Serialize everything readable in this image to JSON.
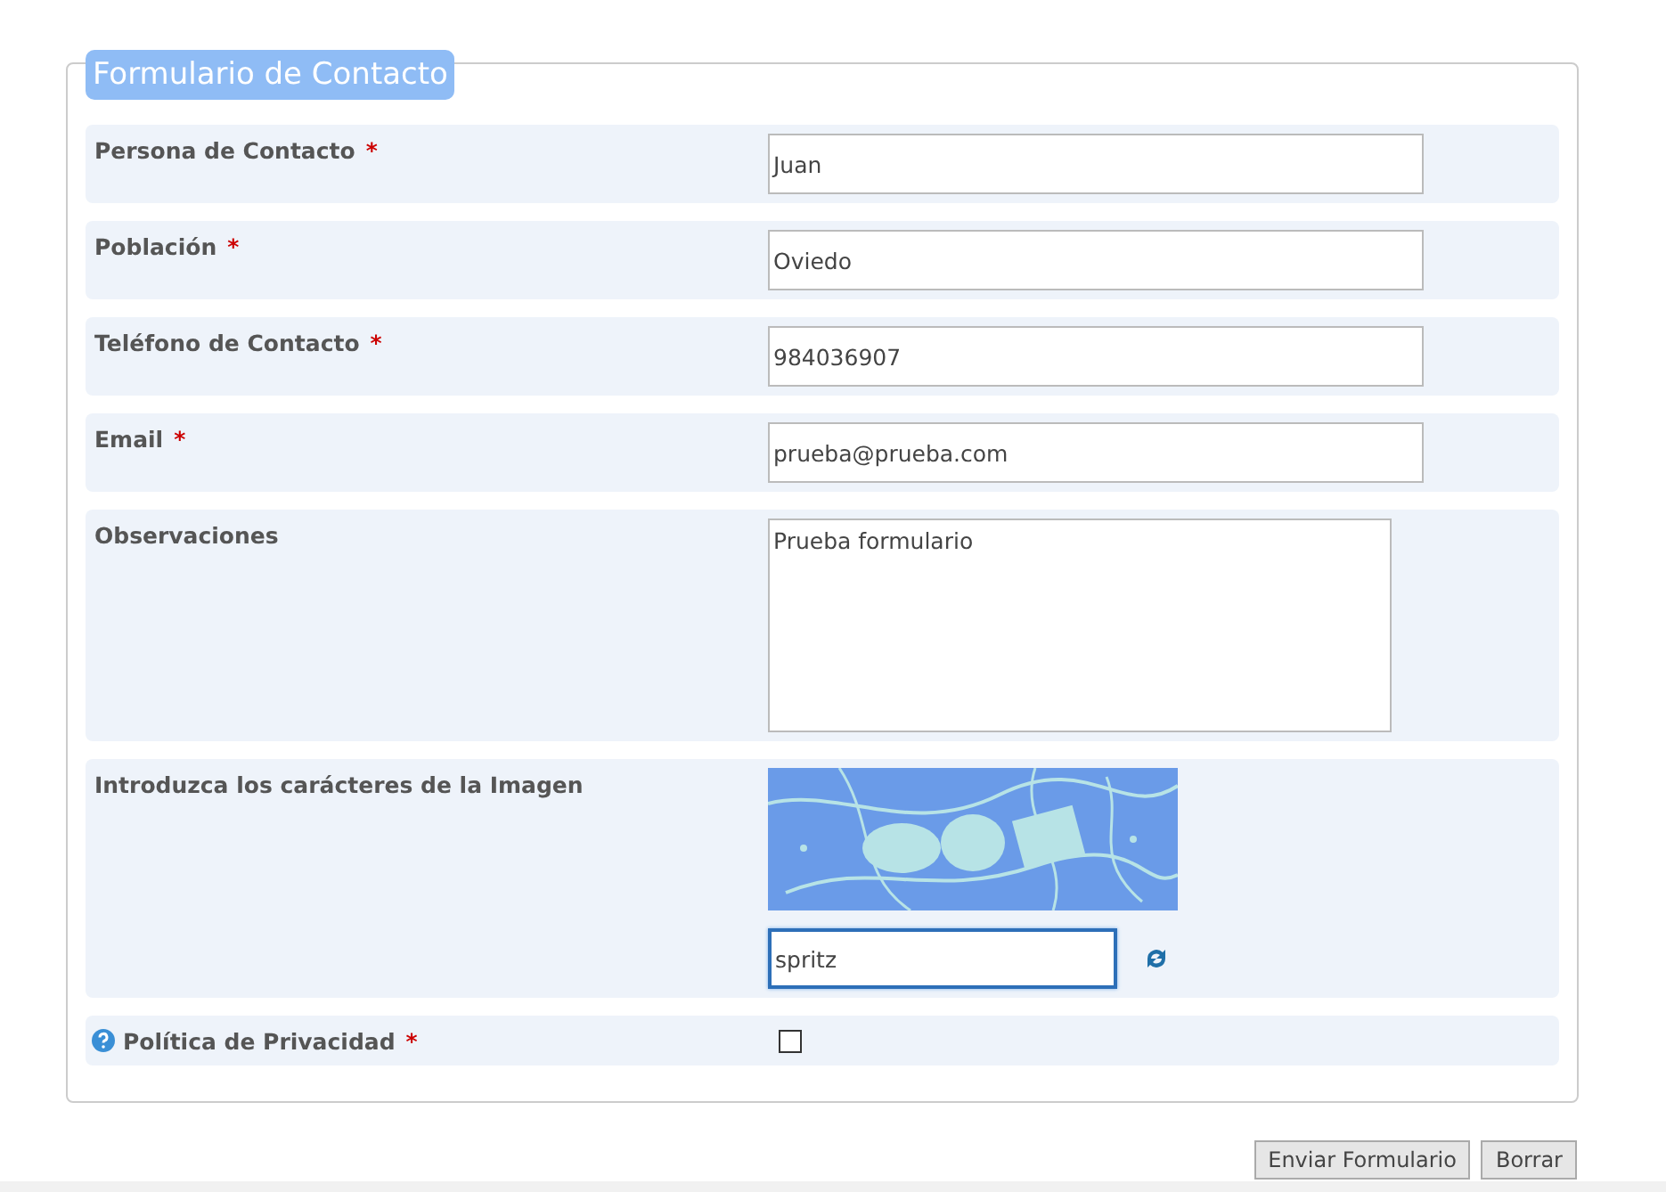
{
  "form": {
    "title": "Formulario de Contacto",
    "fields": [
      {
        "kind": "text",
        "label": "Persona de Contacto",
        "required_mark": "*",
        "value": "Juan",
        "focused": false
      },
      {
        "kind": "text",
        "label": "Población",
        "required_mark": "*",
        "value": "Oviedo",
        "focused": false
      },
      {
        "kind": "text",
        "label": "Teléfono de Contacto",
        "required_mark": "*",
        "value": "984036907",
        "focused": false
      },
      {
        "kind": "text",
        "label": "Email",
        "required_mark": "*",
        "value": "prueba@prueba.com",
        "focused": false
      },
      {
        "kind": "textarea",
        "label": "Observaciones",
        "value": "Prueba formulario",
        "focused": false
      },
      {
        "kind": "captcha",
        "label": "Introduzca los carácteres de la Imagen",
        "value": "spritz",
        "focused": true
      },
      {
        "kind": "checkbox",
        "label": "Política de Privacidad",
        "required_mark": "*",
        "checked": false
      }
    ],
    "buttons": [
      "Enviar Formulario",
      "Borrar"
    ]
  }
}
